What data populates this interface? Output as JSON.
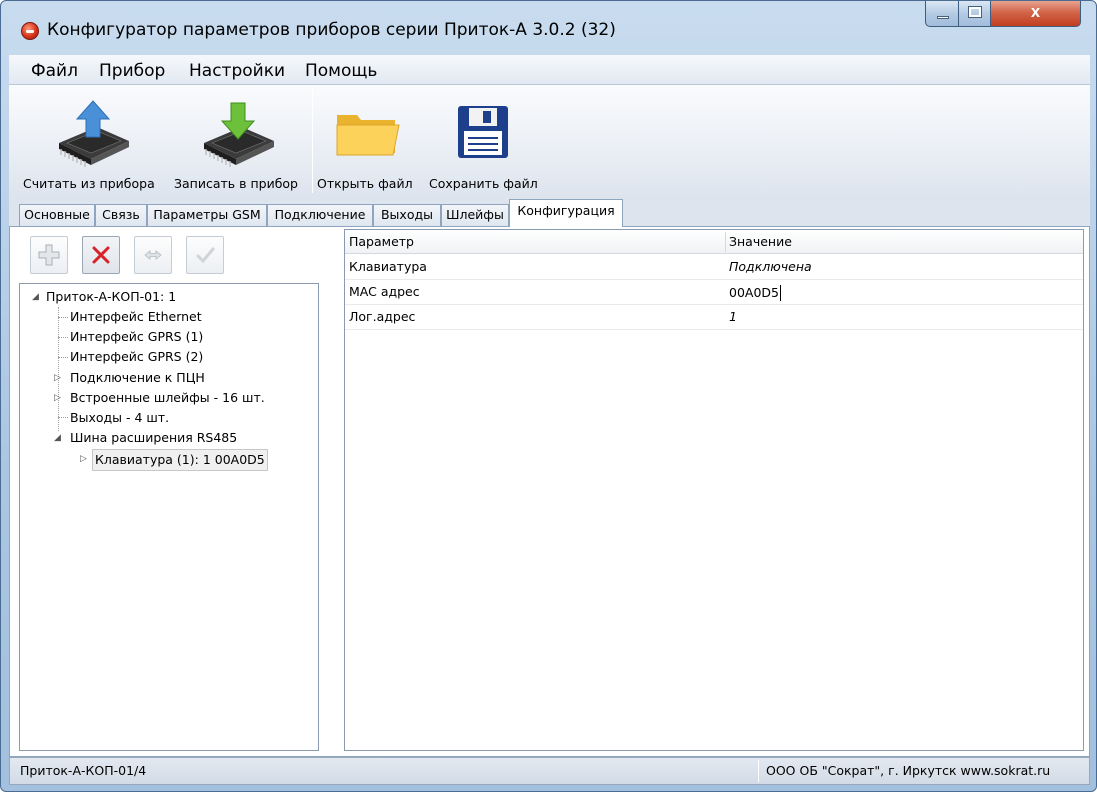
{
  "window": {
    "title": "Конфигуратор параметров приборов серии Приток-А   3.0.2 (32)",
    "close_glyph": "X"
  },
  "menu": {
    "items": [
      "Файл",
      "Прибор",
      "Настройки",
      "Помощь"
    ]
  },
  "toolbar": {
    "read_label": "Считать из прибора",
    "write_label": "Записать в прибор",
    "open_label": "Открыть файл",
    "save_label": "Сохранить файл"
  },
  "tabs": {
    "items": [
      "Основные",
      "Связь",
      "Параметры GSM",
      "Подключение",
      "Выходы",
      "Шлейфы",
      "Конфигурация"
    ],
    "active": "Конфигурация"
  },
  "tree": {
    "root": "Приток-А-КОП-01: 1",
    "items": [
      "Интерфейс Ethernet",
      "Интерфейс GPRS (1)",
      "Интерфейс GPRS (2)",
      "Подключение к ПЦН",
      "Встроенные шлейфы - 16 шт.",
      "Выходы - 4 шт.",
      "Шина расширения RS485"
    ],
    "child": "Клавиатура (1): 1 00A0D5"
  },
  "grid": {
    "col_param": "Параметр",
    "col_value": "Значение",
    "rows": [
      {
        "param": "Клавиатура",
        "value": "Подключена"
      },
      {
        "param": "MAC адрес",
        "value": "00A0D5"
      },
      {
        "param": "Лог.адрес",
        "value": "1"
      }
    ]
  },
  "status": {
    "left": "Приток-А-КОП-01/4",
    "right": "ООО ОБ \"Сократ\", г. Иркутск   www.sokrat.ru"
  }
}
